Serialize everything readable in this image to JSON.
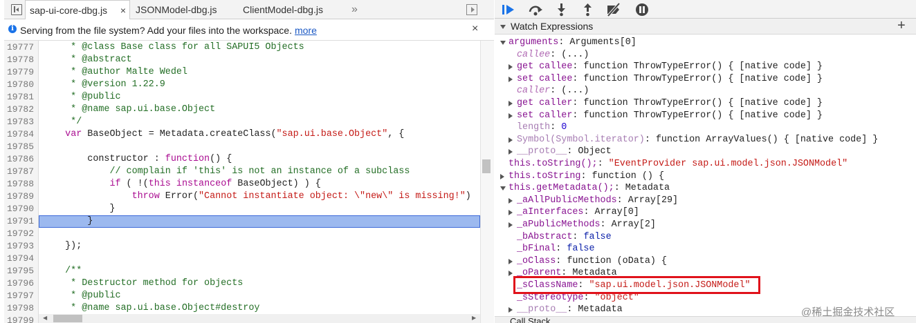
{
  "editor": {
    "tabs": [
      {
        "label": "sap-ui-core-dbg.js",
        "close": "×"
      },
      {
        "label": "JSONModel-dbg.js"
      },
      {
        "label": "ClientModel-dbg.js"
      }
    ],
    "tabs_overflow": "»",
    "infobar": {
      "icon": "i",
      "text": "Serving from the file system? Add your files into the workspace.",
      "link": "more",
      "close": "×"
    },
    "lines": [
      {
        "n": "19777",
        "segs": [
          {
            "t": "     * @class Base class for all SAPUI5 Objects",
            "c": "c"
          }
        ]
      },
      {
        "n": "19778",
        "segs": [
          {
            "t": "     * @abstract",
            "c": "c"
          }
        ]
      },
      {
        "n": "19779",
        "segs": [
          {
            "t": "     * @author Malte Wedel",
            "c": "c"
          }
        ]
      },
      {
        "n": "19780",
        "segs": [
          {
            "t": "     * @version 1.22.9",
            "c": "c"
          }
        ]
      },
      {
        "n": "19781",
        "segs": [
          {
            "t": "     * @public",
            "c": "c"
          }
        ]
      },
      {
        "n": "19782",
        "segs": [
          {
            "t": "     * @name sap.ui.base.Object",
            "c": "c"
          }
        ]
      },
      {
        "n": "19783",
        "segs": [
          {
            "t": "     */",
            "c": "c"
          }
        ]
      },
      {
        "n": "19784",
        "segs": [
          {
            "t": "    ",
            "c": ""
          },
          {
            "t": "var",
            "c": "k"
          },
          {
            "t": " BaseObject = Metadata.createClass(",
            "c": ""
          },
          {
            "t": "\"sap.ui.base.Object\"",
            "c": "s"
          },
          {
            "t": ", {",
            "c": ""
          }
        ]
      },
      {
        "n": "19785",
        "segs": [
          {
            "t": "",
            "c": ""
          }
        ]
      },
      {
        "n": "19786",
        "segs": [
          {
            "t": "        constructor : ",
            "c": ""
          },
          {
            "t": "function",
            "c": "k"
          },
          {
            "t": "() {",
            "c": ""
          }
        ]
      },
      {
        "n": "19787",
        "segs": [
          {
            "t": "            ",
            "c": ""
          },
          {
            "t": "// complain if 'this' is not an instance of a subclass",
            "c": "c"
          }
        ]
      },
      {
        "n": "19788",
        "segs": [
          {
            "t": "            ",
            "c": ""
          },
          {
            "t": "if",
            "c": "k"
          },
          {
            "t": " ( !(",
            "c": ""
          },
          {
            "t": "this",
            "c": "k"
          },
          {
            "t": " ",
            "c": ""
          },
          {
            "t": "instanceof",
            "c": "k"
          },
          {
            "t": " BaseObject) ) {",
            "c": ""
          }
        ]
      },
      {
        "n": "19789",
        "segs": [
          {
            "t": "                ",
            "c": ""
          },
          {
            "t": "throw",
            "c": "k"
          },
          {
            "t": " Error(",
            "c": ""
          },
          {
            "t": "\"Cannot instantiate object: \\\"new\\\" is missing!\"",
            "c": "s"
          },
          {
            "t": ")",
            "c": ""
          }
        ]
      },
      {
        "n": "19790",
        "segs": [
          {
            "t": "            }",
            "c": ""
          }
        ]
      },
      {
        "n": "19791",
        "segs": [
          {
            "t": "        }",
            "c": ""
          }
        ],
        "highlight": true
      },
      {
        "n": "19792",
        "segs": [
          {
            "t": "",
            "c": ""
          }
        ]
      },
      {
        "n": "19793",
        "segs": [
          {
            "t": "    });",
            "c": ""
          }
        ]
      },
      {
        "n": "19794",
        "segs": [
          {
            "t": "",
            "c": ""
          }
        ]
      },
      {
        "n": "19795",
        "segs": [
          {
            "t": "    /**",
            "c": "c"
          }
        ]
      },
      {
        "n": "19796",
        "segs": [
          {
            "t": "     * Destructor method for objects",
            "c": "c"
          }
        ]
      },
      {
        "n": "19797",
        "segs": [
          {
            "t": "     * @public",
            "c": "c"
          }
        ]
      },
      {
        "n": "19798",
        "segs": [
          {
            "t": "     * @name sap.ui.base.Object#destroy",
            "c": "c"
          }
        ]
      },
      {
        "n": "19799",
        "segs": [
          {
            "t": "",
            "c": ""
          }
        ]
      }
    ]
  },
  "debugger": {
    "watch_title": "Watch Expressions",
    "add": "+",
    "call_stack_title": "Call Stack",
    "tree": [
      {
        "lvl": 0,
        "tri": "d",
        "segs": [
          {
            "t": "arguments",
            "c": "p"
          },
          {
            "t": ": Arguments[0]",
            "c": ""
          }
        ]
      },
      {
        "lvl": 1,
        "tri": "",
        "segs": [
          {
            "t": "callee",
            "c": "pi"
          },
          {
            "t": ": (...)",
            "c": ""
          }
        ]
      },
      {
        "lvl": 1,
        "tri": "r",
        "segs": [
          {
            "t": "get callee",
            "c": "p"
          },
          {
            "t": ": function ThrowTypeError() { [native code] }",
            "c": ""
          }
        ]
      },
      {
        "lvl": 1,
        "tri": "r",
        "segs": [
          {
            "t": "set callee",
            "c": "p"
          },
          {
            "t": ": function ThrowTypeError() { [native code] }",
            "c": ""
          }
        ]
      },
      {
        "lvl": 1,
        "tri": "",
        "segs": [
          {
            "t": "caller",
            "c": "pi"
          },
          {
            "t": ": (...)",
            "c": ""
          }
        ]
      },
      {
        "lvl": 1,
        "tri": "r",
        "segs": [
          {
            "t": "get caller",
            "c": "p"
          },
          {
            "t": ": function ThrowTypeError() { [native code] }",
            "c": ""
          }
        ]
      },
      {
        "lvl": 1,
        "tri": "r",
        "segs": [
          {
            "t": "set caller",
            "c": "p"
          },
          {
            "t": ": function ThrowTypeError() { [native code] }",
            "c": ""
          }
        ]
      },
      {
        "lvl": 1,
        "tri": "",
        "segs": [
          {
            "t": "length",
            "c": "pd"
          },
          {
            "t": ": ",
            "c": ""
          },
          {
            "t": "0",
            "c": "nv"
          }
        ]
      },
      {
        "lvl": 1,
        "tri": "r",
        "segs": [
          {
            "t": "Symbol(Symbol.iterator)",
            "c": "pd"
          },
          {
            "t": ": function ArrayValues() { [native code] }",
            "c": ""
          }
        ]
      },
      {
        "lvl": 1,
        "tri": "r",
        "segs": [
          {
            "t": "__proto__",
            "c": "pd"
          },
          {
            "t": ": Object",
            "c": ""
          }
        ]
      },
      {
        "lvl": 0,
        "tri": "",
        "segs": [
          {
            "t": "this.toString();",
            "c": "p"
          },
          {
            "t": ": ",
            "c": ""
          },
          {
            "t": "\"EventProvider sap.ui.model.json.JSONModel\"",
            "c": "sv"
          }
        ]
      },
      {
        "lvl": 0,
        "tri": "r",
        "segs": [
          {
            "t": "this.toString",
            "c": "p"
          },
          {
            "t": ": function () {",
            "c": ""
          }
        ]
      },
      {
        "lvl": 0,
        "tri": "d",
        "segs": [
          {
            "t": "this.getMetadata();",
            "c": "p"
          },
          {
            "t": ": Metadata",
            "c": ""
          }
        ]
      },
      {
        "lvl": 1,
        "tri": "r",
        "segs": [
          {
            "t": "_aAllPublicMethods",
            "c": "p"
          },
          {
            "t": ": Array[29]",
            "c": ""
          }
        ]
      },
      {
        "lvl": 1,
        "tri": "r",
        "segs": [
          {
            "t": "_aInterfaces",
            "c": "p"
          },
          {
            "t": ": Array[0]",
            "c": ""
          }
        ]
      },
      {
        "lvl": 1,
        "tri": "r",
        "segs": [
          {
            "t": "_aPublicMethods",
            "c": "p"
          },
          {
            "t": ": Array[2]",
            "c": ""
          }
        ]
      },
      {
        "lvl": 1,
        "tri": "",
        "segs": [
          {
            "t": "_bAbstract",
            "c": "p"
          },
          {
            "t": ": ",
            "c": ""
          },
          {
            "t": "false",
            "c": "kw"
          }
        ]
      },
      {
        "lvl": 1,
        "tri": "",
        "segs": [
          {
            "t": "_bFinal",
            "c": "p"
          },
          {
            "t": ": ",
            "c": ""
          },
          {
            "t": "false",
            "c": "kw"
          }
        ]
      },
      {
        "lvl": 1,
        "tri": "r",
        "segs": [
          {
            "t": "_oClass",
            "c": "p"
          },
          {
            "t": ": function (oData) {",
            "c": ""
          }
        ]
      },
      {
        "lvl": 1,
        "tri": "r",
        "segs": [
          {
            "t": "_oParent",
            "c": "p"
          },
          {
            "t": ": Metadata",
            "c": ""
          }
        ]
      },
      {
        "lvl": 1,
        "tri": "",
        "segs": [
          {
            "t": "_sClassName",
            "c": "p"
          },
          {
            "t": ": ",
            "c": ""
          },
          {
            "t": "\"sap.ui.model.json.JSONModel\"",
            "c": "sv"
          }
        ]
      },
      {
        "lvl": 1,
        "tri": "",
        "segs": [
          {
            "t": "_sStereotype",
            "c": "p"
          },
          {
            "t": ": ",
            "c": ""
          },
          {
            "t": "\"object\"",
            "c": "sv"
          }
        ]
      },
      {
        "lvl": 1,
        "tri": "r",
        "segs": [
          {
            "t": "__proto__",
            "c": "pd"
          },
          {
            "t": ": Metadata",
            "c": ""
          }
        ]
      }
    ]
  },
  "watermark": "@稀土掘金技术社区",
  "colors": {
    "highlight_line": "#9cb9ef",
    "annotation_box": "#e0121b",
    "accent": "#1a73e8"
  }
}
